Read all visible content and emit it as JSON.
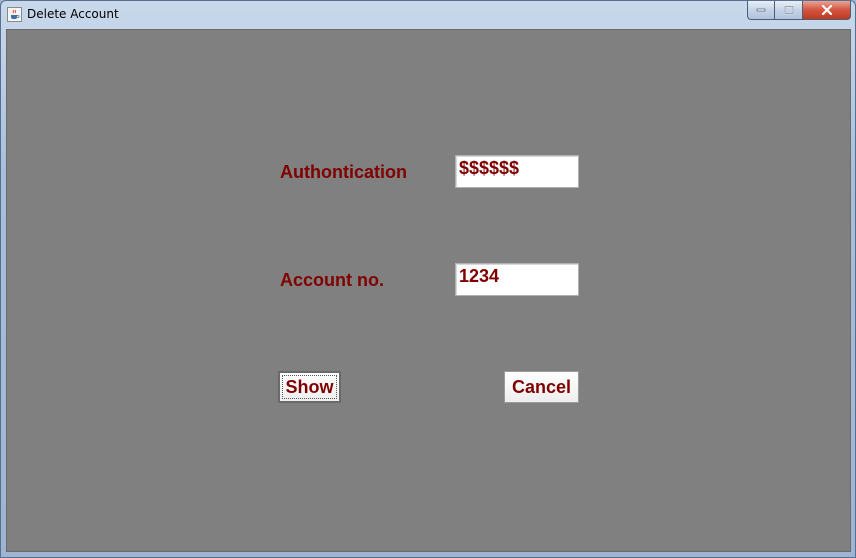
{
  "window": {
    "title": "Delete Account",
    "app_icon": "java-cup-icon",
    "controls": {
      "minimize_icon": "minimize-icon",
      "maximize_icon": "maximize-icon",
      "close_icon": "close-icon"
    }
  },
  "form": {
    "authentication_label": "Authontication",
    "authentication_value": "$$$$$$",
    "account_label": "Account no.",
    "account_value": "1234"
  },
  "buttons": {
    "show_label": "Show",
    "cancel_label": "Cancel"
  },
  "colors": {
    "content_background": "#808080",
    "text_accent": "#800000",
    "field_background": "#ffffff",
    "close_button": "#c0391f"
  }
}
